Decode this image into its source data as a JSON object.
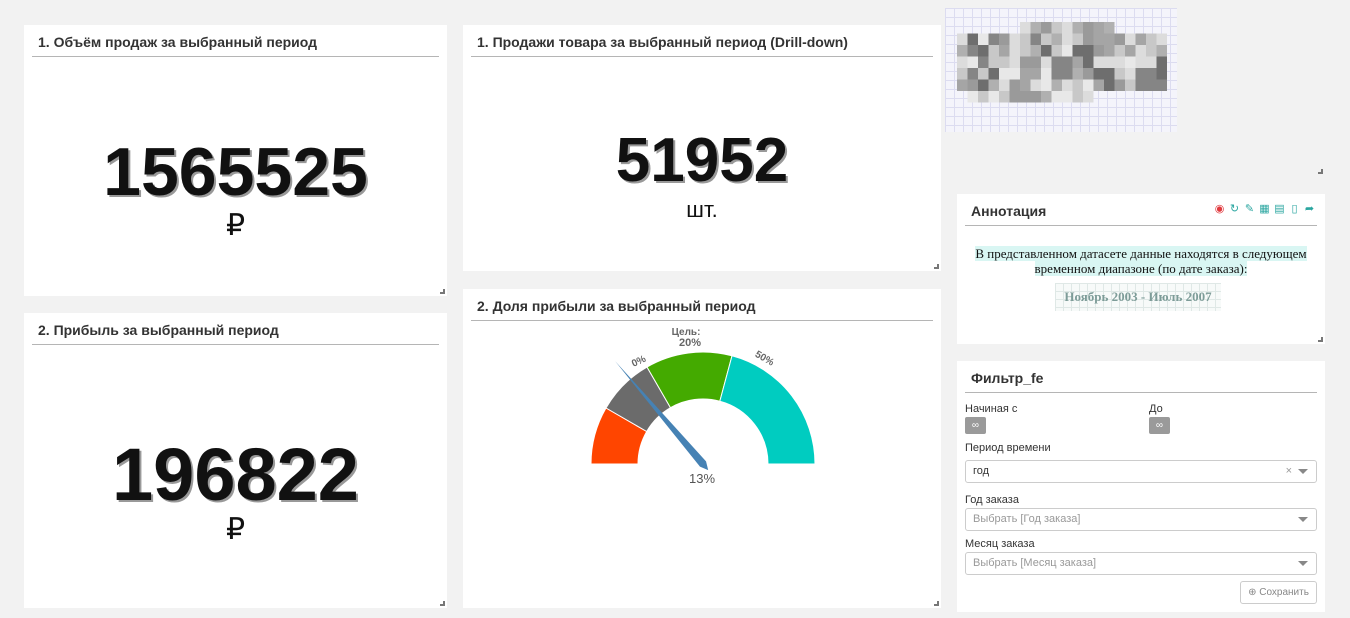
{
  "panel_sales": {
    "title": "1. Объём продаж за выбранный период",
    "value": "1565525",
    "unit": "₽"
  },
  "panel_profit": {
    "title": "2. Прибыль за выбранный период",
    "value": "196822",
    "unit": "₽"
  },
  "panel_items": {
    "title": "1. Продажи товара за выбранный период (Drill-down)",
    "value": "51952",
    "unit": "шт."
  },
  "panel_gauge": {
    "title": "2. Доля прибыли за выбранный период",
    "target_label": "Цель:",
    "target_value": "20%",
    "label_0": "0%",
    "label_50": "50%",
    "value_label": "13%",
    "value_percent": 13,
    "scale_min_percent": -20,
    "scale_max_percent": 100,
    "bands": [
      {
        "from": -20,
        "to": 0,
        "color": "#ff4500"
      },
      {
        "from": 0,
        "to": 20,
        "color": "#6b6b6b"
      },
      {
        "from": 20,
        "to": 50,
        "color": "#44aa00"
      },
      {
        "from": 50,
        "to": 100,
        "color": "#00ccc0"
      }
    ],
    "needle_color": "#4682b4"
  },
  "annotation": {
    "title": "Аннотация",
    "text": "В представленном датасете данные находятся в следующем временном диапазоне (по дате заказа):",
    "range": "Ноябрь 2003 - Июль 2007",
    "icons": [
      "wifi-icon",
      "refresh-icon",
      "edit-icon",
      "table-icon",
      "excel-icon",
      "pdf-icon",
      "share-icon"
    ]
  },
  "filter": {
    "title": "Фильтр_fe",
    "from_label": "Начиная с",
    "to_label": "До",
    "infinity": "∞",
    "period_label": "Период времени",
    "period_value": "год",
    "clear": "×",
    "year_label": "Год заказа",
    "year_placeholder": "Выбрать [Год заказа]",
    "month_label": "Месяц заказа",
    "month_placeholder": "Выбрать [Месяц заказа]",
    "save_label": "Сохранить"
  }
}
